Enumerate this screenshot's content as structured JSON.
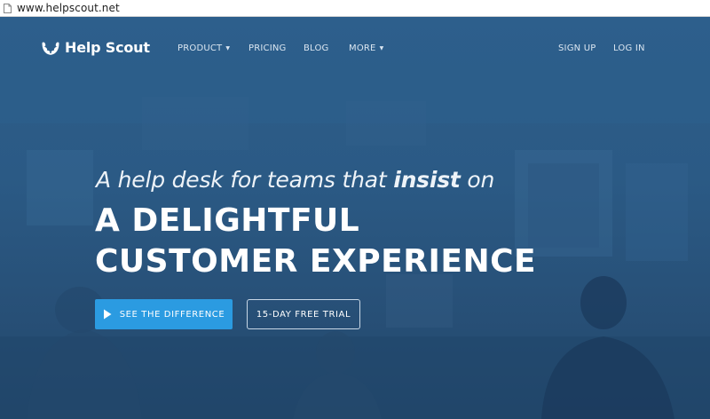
{
  "browser": {
    "url": "www.helpscout.net"
  },
  "nav": {
    "logo_text": "Help Scout",
    "links": [
      {
        "label": "PRODUCT",
        "has_caret": true
      },
      {
        "label": "PRICING",
        "has_caret": false
      },
      {
        "label": "BLOG",
        "has_caret": false
      },
      {
        "label": "MORE",
        "has_caret": true
      }
    ],
    "signup": "SIGN UP",
    "login": "LOG IN",
    "caret": "▼"
  },
  "hero": {
    "tagline_pre": "A help desk for teams that ",
    "tagline_bold": "insist",
    "tagline_post": " on",
    "headline_line1": "A DELIGHTFUL",
    "headline_line2": "CUSTOMER EXPERIENCE",
    "cta_primary": "SEE THE DIFFERENCE",
    "cta_secondary": "15-DAY FREE TRIAL"
  },
  "colors": {
    "hero_bg": "#2b5a85",
    "primary_button": "#2b9be1",
    "text": "#ffffff"
  },
  "icons": {
    "logo": "laurel-wreath-icon",
    "cta": "play-icon",
    "address_bar": "page-icon"
  }
}
